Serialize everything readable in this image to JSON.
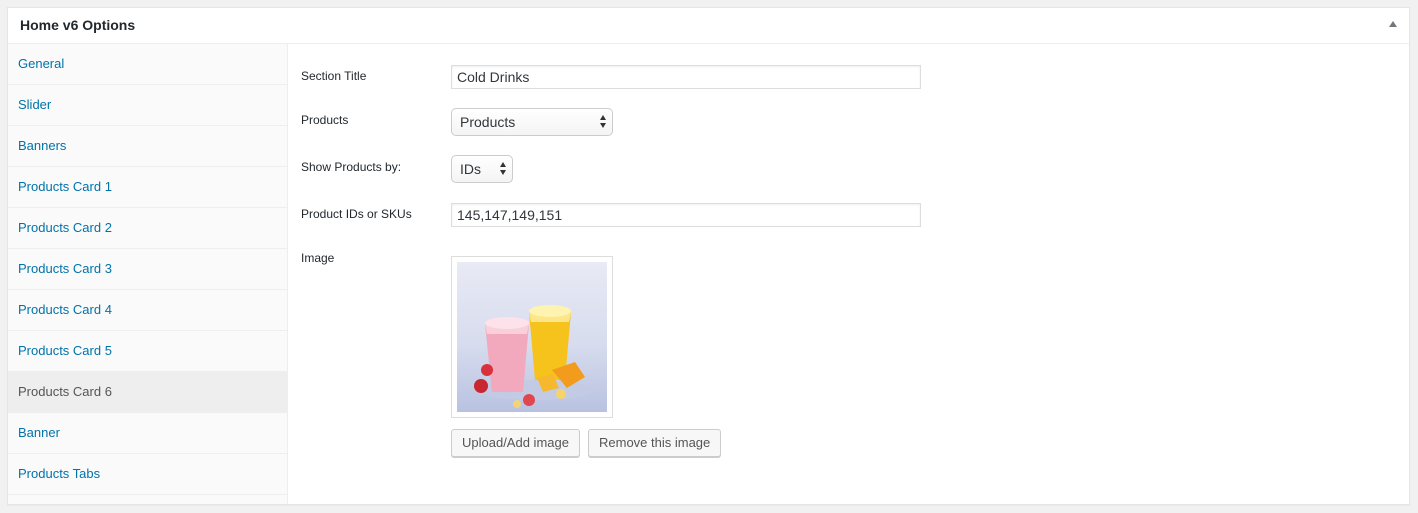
{
  "panel": {
    "title": "Home v6 Options"
  },
  "sidebar": {
    "tabs": [
      {
        "label": "General",
        "active": false
      },
      {
        "label": "Slider",
        "active": false
      },
      {
        "label": "Banners",
        "active": false
      },
      {
        "label": "Products Card 1",
        "active": false
      },
      {
        "label": "Products Card 2",
        "active": false
      },
      {
        "label": "Products Card 3",
        "active": false
      },
      {
        "label": "Products Card 4",
        "active": false
      },
      {
        "label": "Products Card 5",
        "active": false
      },
      {
        "label": "Products Card 6",
        "active": true
      },
      {
        "label": "Banner",
        "active": false
      },
      {
        "label": "Products Tabs",
        "active": false
      }
    ]
  },
  "form": {
    "section_title": {
      "label": "Section Title",
      "value": "Cold Drinks"
    },
    "products": {
      "label": "Products",
      "selected": "Products"
    },
    "show_products_by": {
      "label": "Show Products by:",
      "selected": "IDs"
    },
    "product_ids": {
      "label": "Product IDs or SKUs",
      "value": "145,147,149,151"
    },
    "image": {
      "label": "Image",
      "upload_label": "Upload/Add image",
      "remove_label": "Remove this image"
    }
  },
  "colors": {
    "link": "#0073aa",
    "active_tab_bg": "#eeeeee"
  }
}
